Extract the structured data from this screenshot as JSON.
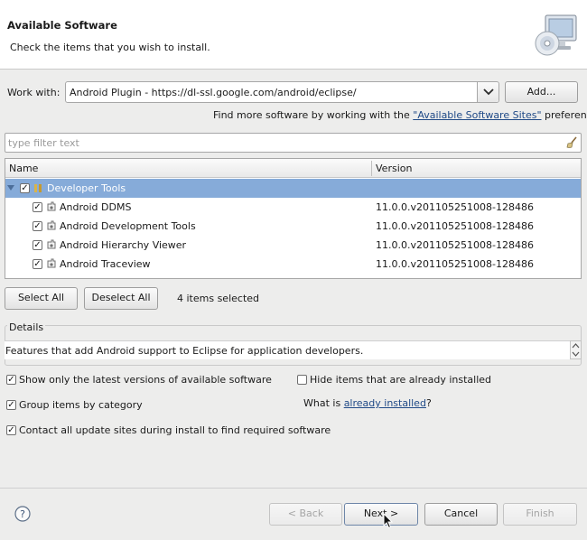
{
  "header": {
    "title": "Available Software",
    "description": "Check the items that you wish to install."
  },
  "work_with": {
    "label": "Work with:",
    "value": "Android Plugin - https://dl-ssl.google.com/android/eclipse/",
    "add_label": "Add...",
    "find_more_prefix": "Find more software by working with the ",
    "find_more_link": "\"Available Software Sites\"",
    "find_more_suffix": " preferences."
  },
  "filter": {
    "placeholder": "type filter text"
  },
  "table": {
    "columns": [
      "Name",
      "Version"
    ],
    "group": {
      "label": "Developer Tools",
      "checked": true
    },
    "rows": [
      {
        "name": "Android DDMS",
        "version": "11.0.0.v201105251008-128486",
        "checked": true
      },
      {
        "name": "Android Development Tools",
        "version": "11.0.0.v201105251008-128486",
        "checked": true
      },
      {
        "name": "Android Hierarchy Viewer",
        "version": "11.0.0.v201105251008-128486",
        "checked": true
      },
      {
        "name": "Android Traceview",
        "version": "11.0.0.v201105251008-128486",
        "checked": true
      }
    ]
  },
  "selection": {
    "select_all": "Select All",
    "deselect_all": "Deselect All",
    "count_text": "4 items selected"
  },
  "details": {
    "label": "Details",
    "text": "Features that add Android support to Eclipse for application developers."
  },
  "options": {
    "latest_only": {
      "label": "Show only the latest versions of available software",
      "checked": true
    },
    "hide_installed": {
      "label": "Hide items that are already installed",
      "checked": false
    },
    "group_by_category": {
      "label": "Group items by category",
      "checked": true
    },
    "what_is_prefix": "What is ",
    "what_is_link": "already installed",
    "what_is_suffix": "?",
    "contact_sites": {
      "label": "Contact all update sites during install to find required software",
      "checked": true
    }
  },
  "footer": {
    "back": "< Back",
    "next": "Next >",
    "cancel": "Cancel",
    "finish": "Finish"
  },
  "colors": {
    "selection": "#86abd9",
    "link": "#204a87"
  },
  "icons": [
    "install-wizard-icon",
    "chevron-down-icon",
    "clear-filter-icon",
    "expand-triangle-icon",
    "feature-icon",
    "plugin-icon",
    "help-icon",
    "mouse-cursor-icon"
  ]
}
